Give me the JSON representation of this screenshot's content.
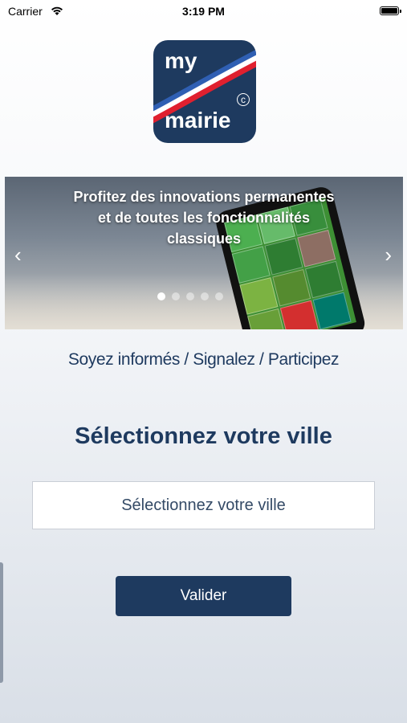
{
  "status_bar": {
    "carrier": "Carrier",
    "time": "3:19 PM"
  },
  "logo": {
    "line1": "my",
    "line2": "mairie",
    "mark": "©",
    "colors": [
      "#1e3a5f",
      "#ffffff",
      "#e0202f"
    ]
  },
  "carousel": {
    "caption_line1": "Profitez des innovations permanentes",
    "caption_line2": "et de toutes les fonctionnalités",
    "caption_line3": "classiques",
    "prev_icon": "‹",
    "next_icon": "›",
    "slide_count": 5,
    "active_slide": 1
  },
  "tagline": "Soyez informés / Signalez / Participez",
  "section_title": "Sélectionnez votre ville",
  "city_select": {
    "placeholder": "Sélectionnez votre ville"
  },
  "validate_label": "Valider",
  "colors": {
    "primary": "#1e3a5f",
    "background": "#eef1f5"
  }
}
